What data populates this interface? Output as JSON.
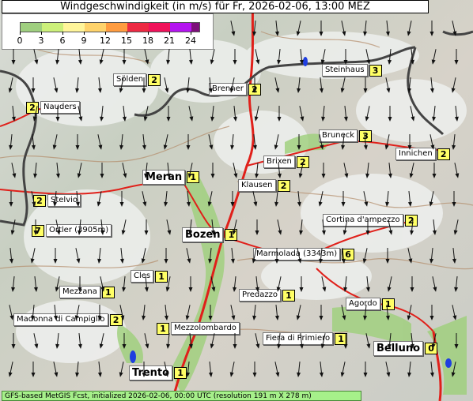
{
  "title": "Windgeschwindigkeit (in m/s) für Fr, 2026-02-06, 13:00 MEZ",
  "legend": {
    "ticks": [
      "0",
      "3",
      "6",
      "9",
      "12",
      "15",
      "18",
      "21",
      "24"
    ],
    "colors": [
      "#9fcf7f",
      "#ccf07a",
      "#fff59a",
      "#ffd36b",
      "#ff9c40",
      "#ee2a43",
      "#f0125a",
      "#b414f0",
      "#7d0f7a"
    ]
  },
  "places": [
    {
      "name": "Sölden",
      "value": "2",
      "major": false
    },
    {
      "name": "Steinhaus",
      "value": "3",
      "major": false
    },
    {
      "name": "Brenner",
      "value": "2",
      "major": false
    },
    {
      "name": "Nauders",
      "value": "2",
      "major": false
    },
    {
      "name": "Bruneck",
      "value": "3",
      "major": false
    },
    {
      "name": "Innichen",
      "value": "2",
      "major": false
    },
    {
      "name": "Brixen",
      "value": "2",
      "major": false
    },
    {
      "name": "Meran",
      "value": "1",
      "major": true
    },
    {
      "name": "Klausen",
      "value": "2",
      "major": false
    },
    {
      "name": "Stelvio",
      "value": "2",
      "major": false
    },
    {
      "name": "Cortina d'ampezzo",
      "value": "2",
      "major": false
    },
    {
      "name": "Ortler (3905m)",
      "value": "7",
      "major": false
    },
    {
      "name": "Bozen",
      "value": "1",
      "major": true
    },
    {
      "name": "Marmolada (3343m)",
      "value": "6",
      "major": false
    },
    {
      "name": "Cles",
      "value": "1",
      "major": false
    },
    {
      "name": "Mezzana",
      "value": "1",
      "major": false
    },
    {
      "name": "Predazzo",
      "value": "1",
      "major": false
    },
    {
      "name": "Agordo",
      "value": "1",
      "major": false
    },
    {
      "name": "Madonna di Campiglio",
      "value": "2",
      "major": false
    },
    {
      "name": "Mezzolombardo",
      "value": "1",
      "major": false
    },
    {
      "name": "Fiera di Primiero",
      "value": "1",
      "major": false
    },
    {
      "name": "Belluno",
      "value": "0",
      "major": true
    },
    {
      "name": "Trento",
      "value": "1",
      "major": true
    }
  ],
  "footer": "GFS-based MetGIS Fcst, initialized 2026-02-06, 00:00 UTC  (resolution 191 m X 278 m)",
  "wind": {
    "direction": "north"
  }
}
